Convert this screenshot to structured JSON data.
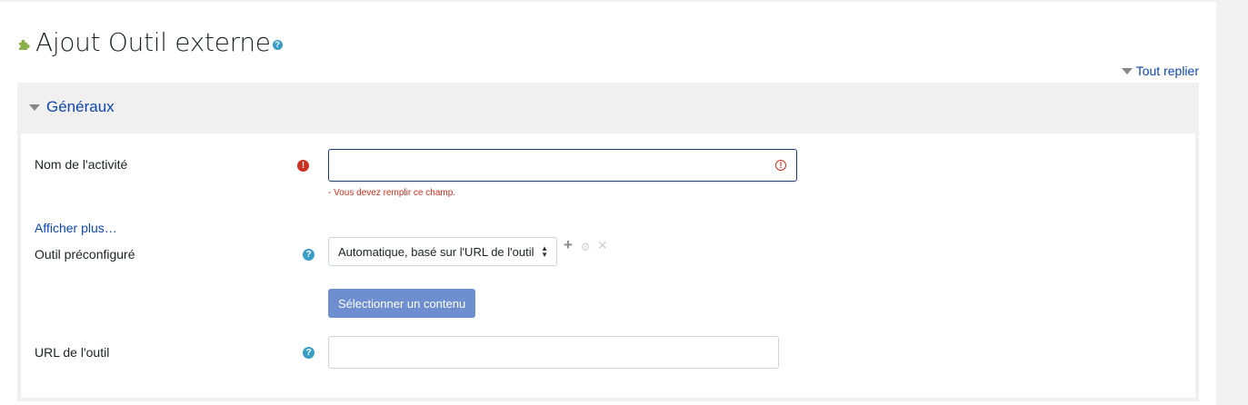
{
  "header": {
    "title": "Ajout Outil externe",
    "title_icon": "puzzle-icon",
    "help_icon": "question-icon"
  },
  "collapse_all": {
    "label": "Tout replier"
  },
  "section": {
    "legend": "Généraux"
  },
  "fields": {
    "activity_name": {
      "label": "Nom de l'activité",
      "value": "",
      "error": "- Vous devez remplir ce champ."
    },
    "show_more": "Afficher plus…",
    "preconfigured_tool": {
      "label": "Outil préconfiguré",
      "selected": "Automatique, basé sur l'URL de l'outil"
    },
    "select_content_button": "Sélectionner un contenu",
    "tool_url": {
      "label": "URL de l'outil",
      "value": ""
    }
  },
  "colors": {
    "link": "#0f47ad",
    "error": "#ca3120",
    "help": "#3a9dc5",
    "button": "#6e8fcf"
  }
}
